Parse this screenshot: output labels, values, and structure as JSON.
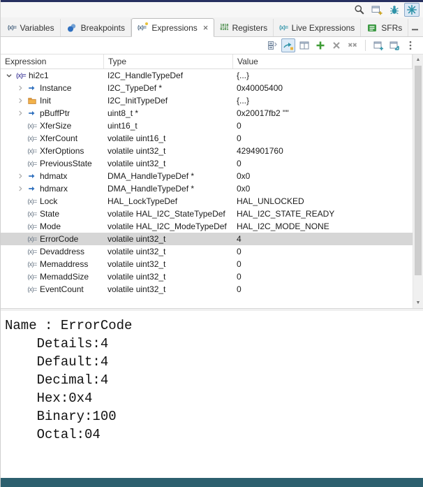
{
  "colors": {
    "selection_bg": "#d6d6d6",
    "top_accent": "#273060",
    "bottom_bar": "#2c5f6e",
    "add_green": "#3f9c35",
    "pressed_button_bg": "#dcebf8"
  },
  "topbar": {
    "icons": [
      {
        "name": "search",
        "active": false
      },
      {
        "name": "open-perspective",
        "active": false
      },
      {
        "name": "debug-perspective",
        "active": false
      },
      {
        "name": "device-configuration-perspective",
        "active": true
      }
    ]
  },
  "tabs": [
    {
      "slug": "variables",
      "label": "Variables",
      "icon": "variables",
      "active": false
    },
    {
      "slug": "breakpoints",
      "label": "Breakpoints",
      "icon": "breakpoints",
      "active": false
    },
    {
      "slug": "expressions",
      "label": "Expressions",
      "icon": "expressions",
      "active": true,
      "close_glyph": "×"
    },
    {
      "slug": "registers",
      "label": "Registers",
      "icon": "registers",
      "active": false
    },
    {
      "slug": "live-expressions",
      "label": "Live Expressions",
      "icon": "live-expressions",
      "active": false
    },
    {
      "slug": "sfrs",
      "label": "SFRs",
      "icon": "sfrs",
      "active": false
    }
  ],
  "window_controls": [
    {
      "name": "minimize"
    },
    {
      "name": "maximize"
    }
  ],
  "view_toolbar": {
    "buttons": [
      {
        "name": "collapse-all",
        "pressed": false
      },
      {
        "name": "show-logical-structure",
        "pressed": true
      },
      {
        "name": "layout",
        "pressed": false
      },
      {
        "name": "add-expression",
        "pressed": false
      },
      {
        "name": "remove-expression",
        "pressed": false
      },
      {
        "name": "remove-all-expressions",
        "pressed": false
      },
      {
        "name": "separator"
      },
      {
        "name": "new-view",
        "pressed": false
      },
      {
        "name": "pin-view",
        "pressed": false
      },
      {
        "name": "view-menu",
        "pressed": false
      }
    ]
  },
  "table": {
    "columns": [
      {
        "label": "Expression",
        "width": 148
      },
      {
        "label": "Type",
        "width": 185
      },
      {
        "label": "Value",
        "width": null
      }
    ],
    "rows": [
      {
        "level": 0,
        "expander": "open",
        "icon": "watch",
        "name": "hi2c1",
        "type": "I2C_HandleTypeDef",
        "value": "{...}",
        "selected": false
      },
      {
        "level": 1,
        "expander": "closed",
        "icon": "pointer",
        "name": "Instance",
        "type": "I2C_TypeDef *",
        "value": "0x40005400",
        "selected": false
      },
      {
        "level": 1,
        "expander": "closed",
        "icon": "struct",
        "name": "Init",
        "type": "I2C_InitTypeDef",
        "value": "{...}",
        "selected": false
      },
      {
        "level": 1,
        "expander": "closed",
        "icon": "pointer",
        "name": "pBuffPtr",
        "type": "uint8_t *",
        "value": "0x20017fb2 \"\"",
        "selected": false
      },
      {
        "level": 1,
        "expander": "none",
        "icon": "scalar",
        "name": "XferSize",
        "type": "uint16_t",
        "value": "0",
        "selected": false
      },
      {
        "level": 1,
        "expander": "none",
        "icon": "scalar",
        "name": "XferCount",
        "type": "volatile uint16_t",
        "value": "0",
        "selected": false
      },
      {
        "level": 1,
        "expander": "none",
        "icon": "scalar",
        "name": "XferOptions",
        "type": "volatile uint32_t",
        "value": "4294901760",
        "selected": false
      },
      {
        "level": 1,
        "expander": "none",
        "icon": "scalar",
        "name": "PreviousState",
        "type": "volatile uint32_t",
        "value": "0",
        "selected": false
      },
      {
        "level": 1,
        "expander": "closed",
        "icon": "pointer",
        "name": "hdmatx",
        "type": "DMA_HandleTypeDef *",
        "value": "0x0",
        "selected": false
      },
      {
        "level": 1,
        "expander": "closed",
        "icon": "pointer",
        "name": "hdmarx",
        "type": "DMA_HandleTypeDef *",
        "value": "0x0",
        "selected": false
      },
      {
        "level": 1,
        "expander": "none",
        "icon": "scalar",
        "name": "Lock",
        "type": "HAL_LockTypeDef",
        "value": "HAL_UNLOCKED",
        "selected": false
      },
      {
        "level": 1,
        "expander": "none",
        "icon": "scalar",
        "name": "State",
        "type": "volatile HAL_I2C_StateTypeDef",
        "value": "HAL_I2C_STATE_READY",
        "selected": false
      },
      {
        "level": 1,
        "expander": "none",
        "icon": "scalar",
        "name": "Mode",
        "type": "volatile HAL_I2C_ModeTypeDef",
        "value": "HAL_I2C_MODE_NONE",
        "selected": false
      },
      {
        "level": 1,
        "expander": "none",
        "icon": "scalar",
        "name": "ErrorCode",
        "type": "volatile uint32_t",
        "value": "4",
        "selected": true
      },
      {
        "level": 1,
        "expander": "none",
        "icon": "scalar",
        "name": "Devaddress",
        "type": "volatile uint32_t",
        "value": "0",
        "selected": false
      },
      {
        "level": 1,
        "expander": "none",
        "icon": "scalar",
        "name": "Memaddress",
        "type": "volatile uint32_t",
        "value": "0",
        "selected": false
      },
      {
        "level": 1,
        "expander": "none",
        "icon": "scalar",
        "name": "MemaddSize",
        "type": "volatile uint32_t",
        "value": "0",
        "selected": false
      },
      {
        "level": 1,
        "expander": "none",
        "icon": "scalar",
        "name": "EventCount",
        "type": "volatile uint32_t",
        "value": "0",
        "selected": false
      }
    ]
  },
  "details": {
    "lines": [
      "Name : ErrorCode",
      "    Details:4",
      "    Default:4",
      "    Decimal:4",
      "    Hex:0x4",
      "    Binary:100",
      "    Octal:04"
    ]
  }
}
